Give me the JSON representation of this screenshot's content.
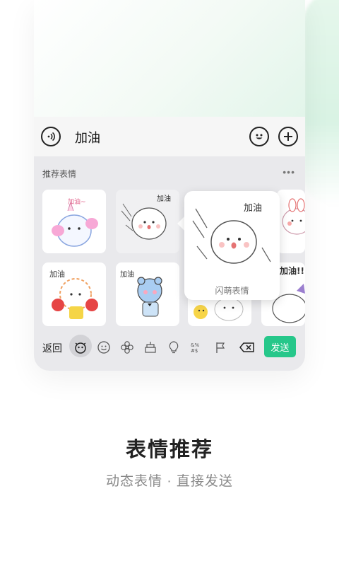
{
  "chat_input": {
    "value": "加油"
  },
  "keyboard": {
    "section_title": "推荐表情",
    "more_label": "•••",
    "popup_label": "闪萌表情",
    "stickers": [
      {
        "name": "unicorn-cat-sticker",
        "caption": "加油~"
      },
      {
        "name": "bun-cheer-sticker",
        "caption": "加油"
      },
      {
        "name": "rabbit-sticker",
        "caption": ""
      },
      {
        "name": "cloud-lion-sticker",
        "caption": "加油"
      },
      {
        "name": "bear-sticker",
        "caption": "加油"
      },
      {
        "name": "chick-bun-sticker",
        "caption": ""
      },
      {
        "name": "duck-sticker",
        "caption": "加油!!"
      }
    ],
    "popup_caption": "加油"
  },
  "toolbar": {
    "back_label": "返回",
    "send_label": "发送",
    "icons": [
      "sticker-face-icon",
      "smiley-icon",
      "flower-icon",
      "cake-icon",
      "lightbulb-icon",
      "symbols-icon",
      "flag-icon",
      "backspace-icon"
    ]
  },
  "footer": {
    "title": "表情推荐",
    "subtitle": "动态表情 · 直接发送"
  },
  "colors": {
    "accent": "#26c78a",
    "keyboard_bg": "#e9e9ec"
  }
}
